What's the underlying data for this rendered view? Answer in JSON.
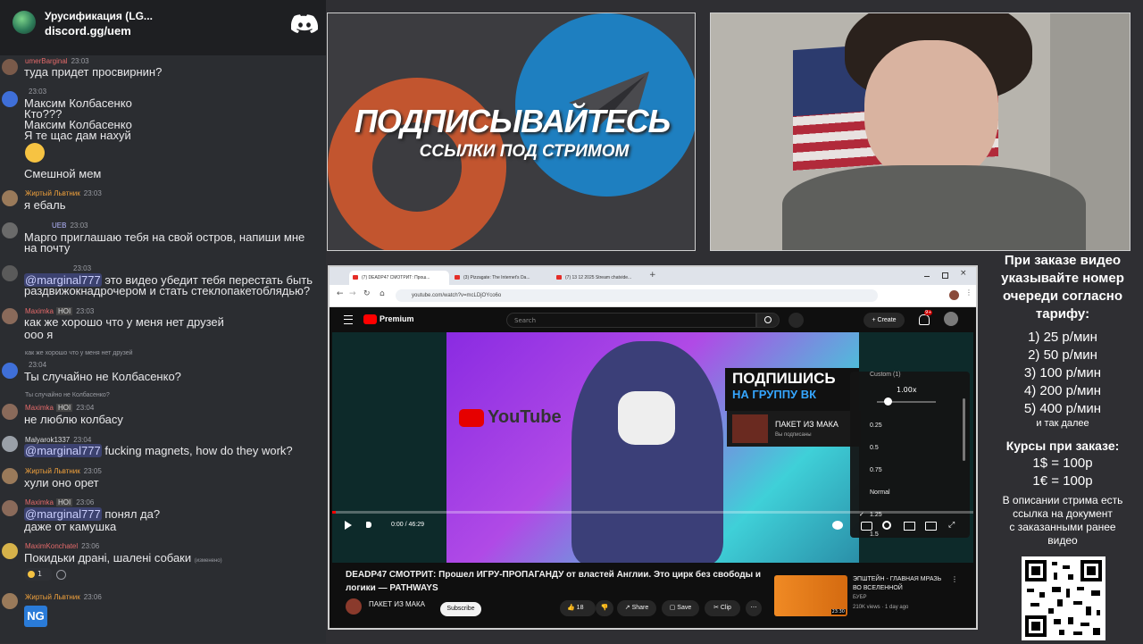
{
  "server": {
    "name": "Урусификация (LG...",
    "invite": "discord.gg/uem"
  },
  "messages": [
    {
      "user": "umerBarginal",
      "time": "23:03",
      "lines": [
        "туда придет просвирнин?"
      ]
    },
    {
      "user": "",
      "time": "23:03",
      "lines": [
        "Максим Колбасенко",
        "Кто???",
        "Максим Колбасенко",
        "Я те щас дам нахуй",
        "",
        "Смешной мем"
      ]
    },
    {
      "user": "Жиртый Львтник",
      "time": "23:03",
      "lines": [
        "я ебаль"
      ]
    },
    {
      "user": "",
      "badge": "UEB",
      "time": "23:03",
      "lines": [
        "Марго приглашаю тебя на свой остров, напиши мне",
        "на почту"
      ]
    },
    {
      "user": "",
      "time": "23:03",
      "mention": "@marginal777",
      "lines": [
        " это видео убедит тебя перестать быть",
        "раздвижокнадрочером и стать стеклопакетоблядью?"
      ]
    },
    {
      "user": "Maximka",
      "badge": "HOI",
      "time": "23:03",
      "lines": [
        "как же хорошо что у меня нет друзей",
        "ооо я"
      ]
    },
    {
      "reply": "как же хорошо что у меня нет друзей",
      "user": "",
      "time": "23:04",
      "lines": [
        "Ты случайно не Колбасенко?"
      ]
    },
    {
      "reply": "Ты случайно не Колбасенко?",
      "user": "Maximka",
      "badge": "HOI",
      "time": "23:04",
      "lines": [
        "не люблю колбасу"
      ]
    },
    {
      "user": "Malyarok1337",
      "time": "23:04",
      "mention": "@marginal777",
      "lines": [
        " fucking magnets, how do they work?"
      ]
    },
    {
      "user": "Жиртый Львтник",
      "time": "23:05",
      "lines": [
        "хули оно орет"
      ]
    },
    {
      "user": "Maximka",
      "badge": "HOI",
      "time": "23:06",
      "mention": "@marginal777",
      "lines": [
        " понял да?",
        "даже от камушка"
      ]
    },
    {
      "user": "MaximKonchatel",
      "time": "23:06",
      "lines": [
        "Покидьки драні, шалені собаки"
      ],
      "edited": "(изменено)",
      "reaction": "1"
    },
    {
      "user": "Жиртый Львтник",
      "time": "23:06",
      "lines": [
        "NG"
      ]
    }
  ],
  "promo": {
    "title": "ПОДПИСЫВАЙТЕСЬ",
    "subtitle": "ССЫЛКИ ПОД СТРИМОМ"
  },
  "browser": {
    "tabs": [
      "(7) DEADP47 СМОТРИТ: Прош...",
      "(3) Pizzagate: The Internet's Da...",
      "(7) 13 12 2025 Stream chatvide..."
    ],
    "url": "youtube.com/watch?v=mcLDjOYco6o",
    "yt_brand": "Premium",
    "search_placeholder": "Search",
    "create_label": "Create",
    "notif_count": "9+",
    "thumb_brand": "YouTube",
    "card_line1": "ПОДПИШИСЬ",
    "card_line2": "НА ГРУППУ ВК",
    "card_channel": "ПАКЕТ ИЗ МАКА",
    "card_status": "Вы подписаны",
    "speed_header": "Custom (1)",
    "speed_value": "1.00x",
    "speed_options": [
      "0.25",
      "0.5",
      "0.75",
      "Normal",
      "1.25",
      "1.5"
    ],
    "time": "0:00 / 46:29",
    "progress": 0.004,
    "title": "DEADP47 СМОТРИТ: Прошел ИГРУ-ПРОПАГАНДУ от властей Англии. Это цирк без свободы и логики — PATHWAYS",
    "channel": "ПАКЕТ ИЗ МАКА",
    "subscribe": "Subscribe",
    "likes": "18",
    "share": "Share",
    "save": "Save",
    "clip": "Clip",
    "rec_title": "ЭПШТЕЙН - ГЛАВНАЯ МРАЗЬ ВО ВСЕЛЕННОЙ",
    "rec_channel": "БУБР",
    "rec_meta": "210K views · 1 day ago",
    "rec_duration": "23:30"
  },
  "info": {
    "heading": [
      "При заказе видео",
      "указывайте номер",
      "очереди согласно",
      "тарифу:"
    ],
    "prices": [
      "1) 25 р/мин",
      "2) 50 р/мин",
      "3) 100 р/мин",
      "4) 200 р/мин",
      "5) 400 р/мин"
    ],
    "etc": "и так далее",
    "rates_title": "Курсы при заказе:",
    "rates": [
      "1$ = 100р",
      "1€ = 100р"
    ],
    "desc": [
      "В описании стрима есть",
      "ссылка на документ",
      "с заказанными ранее",
      "видео"
    ]
  },
  "colors": {
    "accent_red": "#ff0000",
    "discord_bg": "#2b2d31",
    "mention_bg": "#3c4270"
  }
}
